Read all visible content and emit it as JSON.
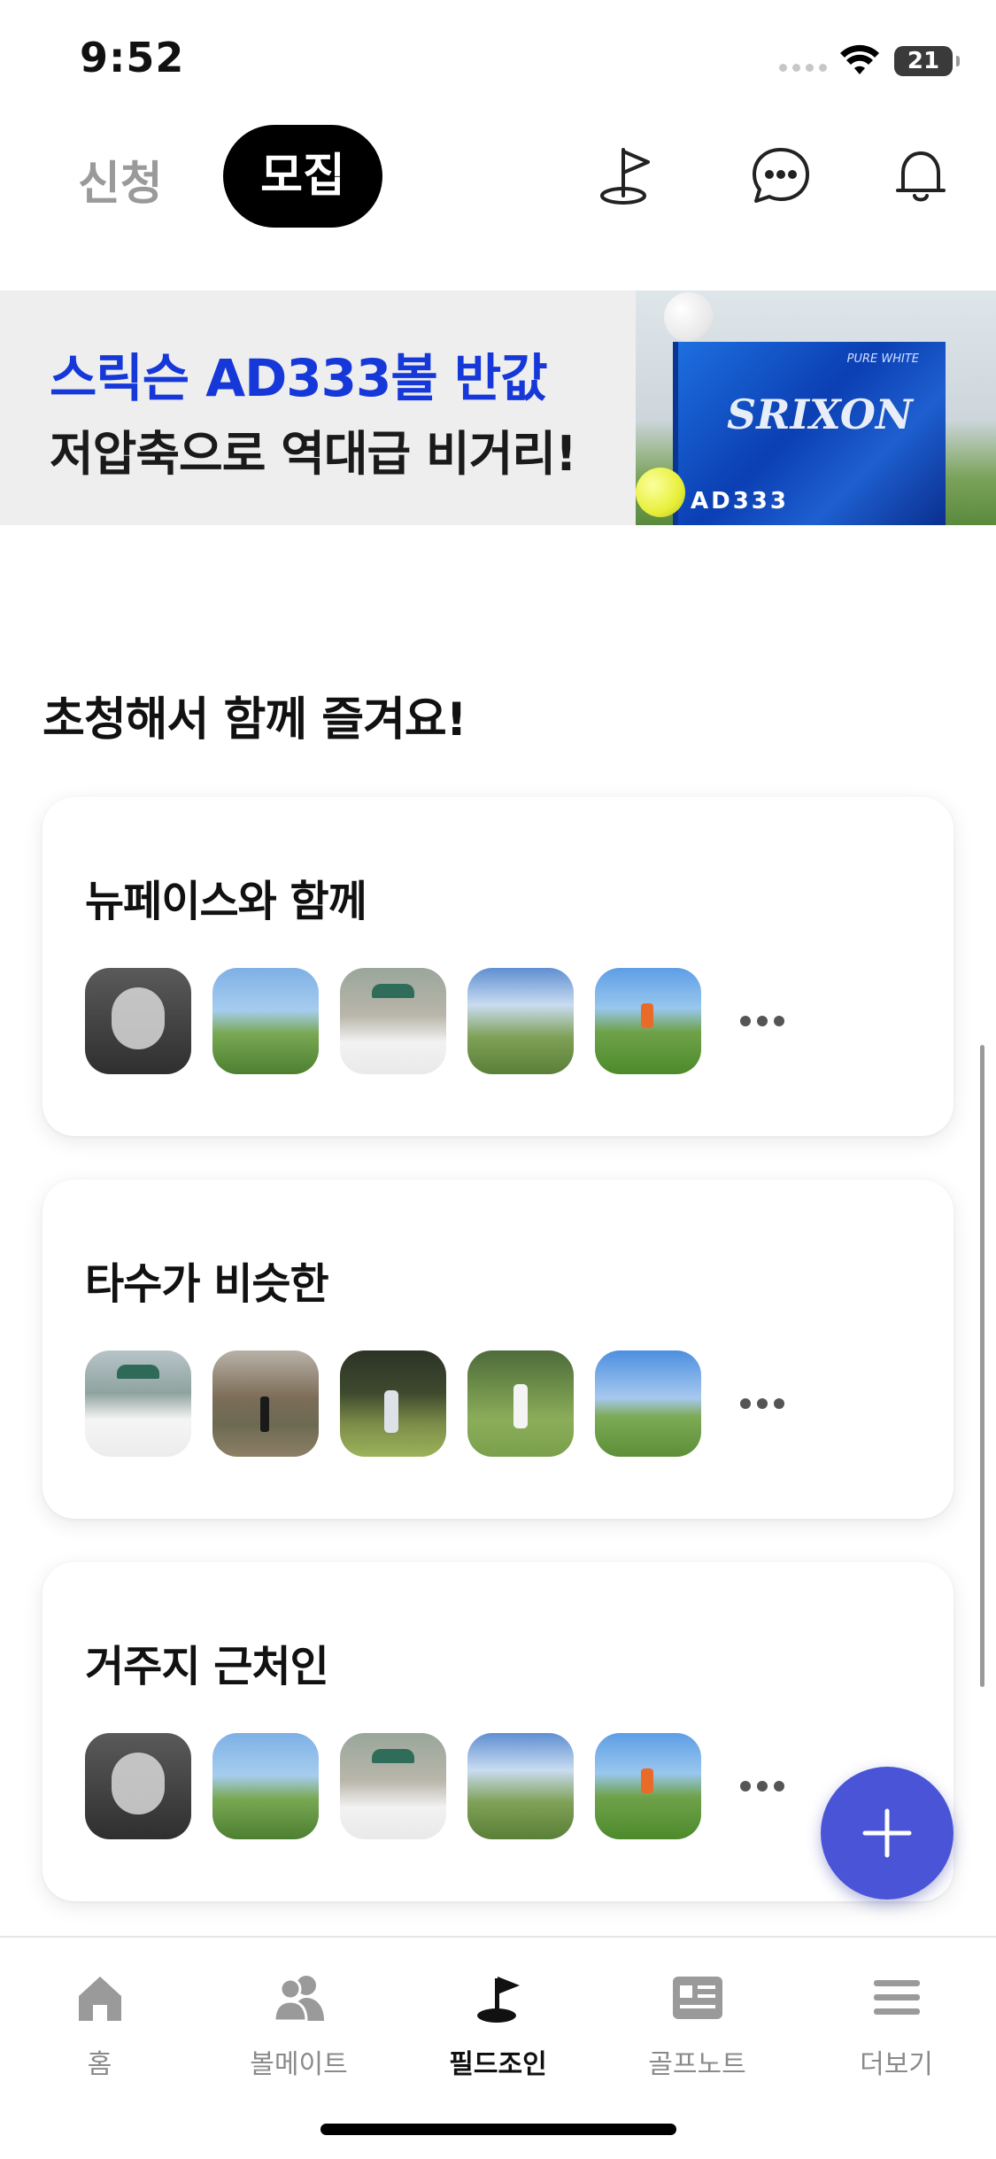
{
  "status_bar": {
    "time": "9:52",
    "battery": "21"
  },
  "top_nav": {
    "tabs": [
      {
        "label": "신청",
        "active": false
      },
      {
        "label": "모집",
        "active": true
      }
    ],
    "icons": [
      "flag-icon",
      "chat-icon",
      "bell-icon"
    ]
  },
  "banner": {
    "title": "스릭슨 AD333볼 반값",
    "subtitle": "저압축으로 역대급 비거리!",
    "product_logo": "SRIXON",
    "product_model": "AD333",
    "product_variant": "PURE WHITE"
  },
  "section": {
    "title": "초청해서 함께 즐겨요!"
  },
  "groups": [
    {
      "title": "뉴페이스와 함께",
      "avatars": [
        "mono-portrait",
        "course-photo",
        "cap-portrait",
        "cloudy-course",
        "tee-shot"
      ]
    },
    {
      "title": "타수가 비슷한",
      "avatars": [
        "cap-portrait",
        "forest-course",
        "swing-photo",
        "fairway-photo",
        "range-photo"
      ]
    },
    {
      "title": "거주지 근처인",
      "avatars": [
        "mono-portrait",
        "course-photo",
        "cap-portrait",
        "cloudy-course",
        "tee-shot"
      ]
    }
  ],
  "fab": {
    "icon": "plus-icon",
    "color": "#4a54d6"
  },
  "tab_bar": {
    "items": [
      {
        "label": "홈",
        "icon": "home-icon",
        "active": false
      },
      {
        "label": "볼메이트",
        "icon": "people-icon",
        "active": false
      },
      {
        "label": "필드조인",
        "icon": "golf-flag-icon",
        "active": true
      },
      {
        "label": "골프노트",
        "icon": "note-icon",
        "active": false
      },
      {
        "label": "더보기",
        "icon": "menu-icon",
        "active": false
      }
    ]
  },
  "colors": {
    "accent": "#4a54d6",
    "banner_title": "#1638d9",
    "inactive": "#8a8a8a"
  }
}
